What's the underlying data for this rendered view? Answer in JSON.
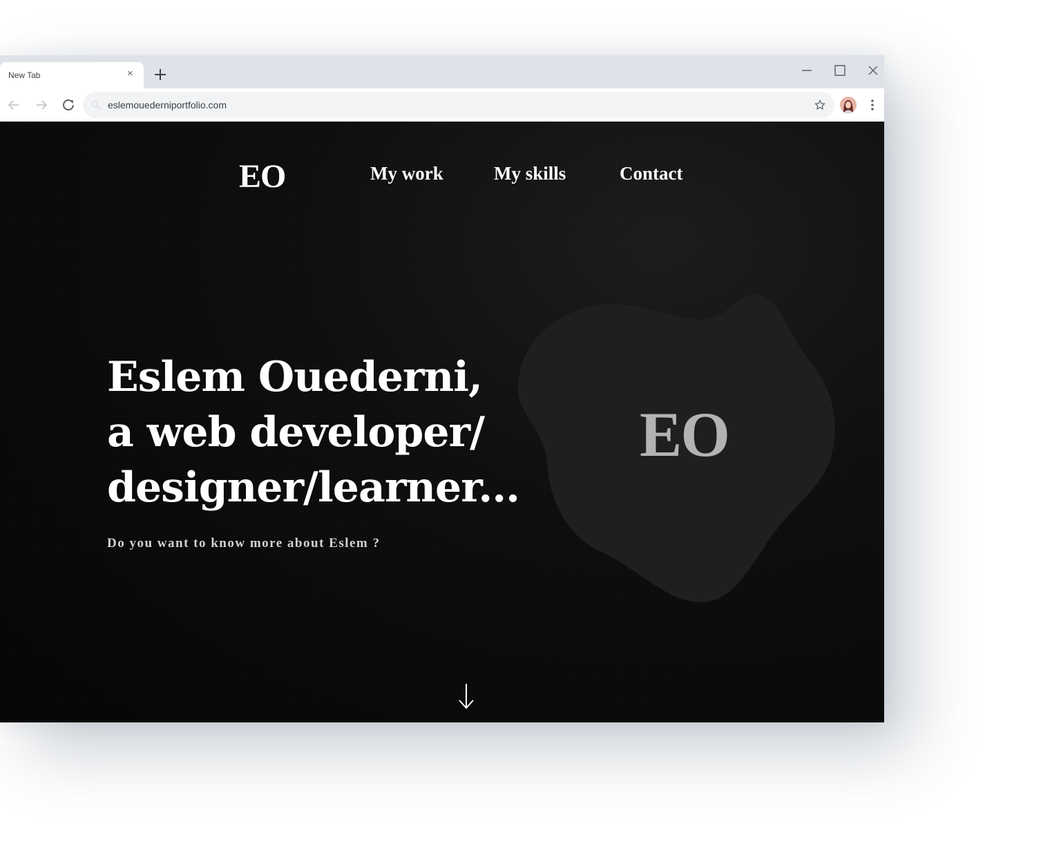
{
  "browser": {
    "tab_title": "New Tab",
    "tab_close": "×",
    "url": "eslemouederniportfolio.com"
  },
  "site": {
    "logo": "EO",
    "nav": [
      {
        "label": "My work"
      },
      {
        "label": "My skills"
      },
      {
        "label": "Contact"
      }
    ],
    "hero": {
      "lines": [
        "Eslem Ouederni,",
        "a web developer/",
        "designer/learner..."
      ],
      "subtitle": "Do you want to know more about Eslem ?"
    },
    "blob_mark": "EO"
  },
  "colors": {
    "tabstrip": "#dee3e9",
    "page_bg": "#0a0a0a",
    "blob": "#1e1e1e",
    "blob_text": "#b3b3b3"
  },
  "icons": [
    "back-icon",
    "forward-icon",
    "reload-icon",
    "search-icon",
    "star-icon",
    "profile-avatar",
    "menu-icon",
    "new-tab-icon",
    "minimize-icon",
    "maximize-icon",
    "close-icon",
    "arrow-down-icon"
  ]
}
